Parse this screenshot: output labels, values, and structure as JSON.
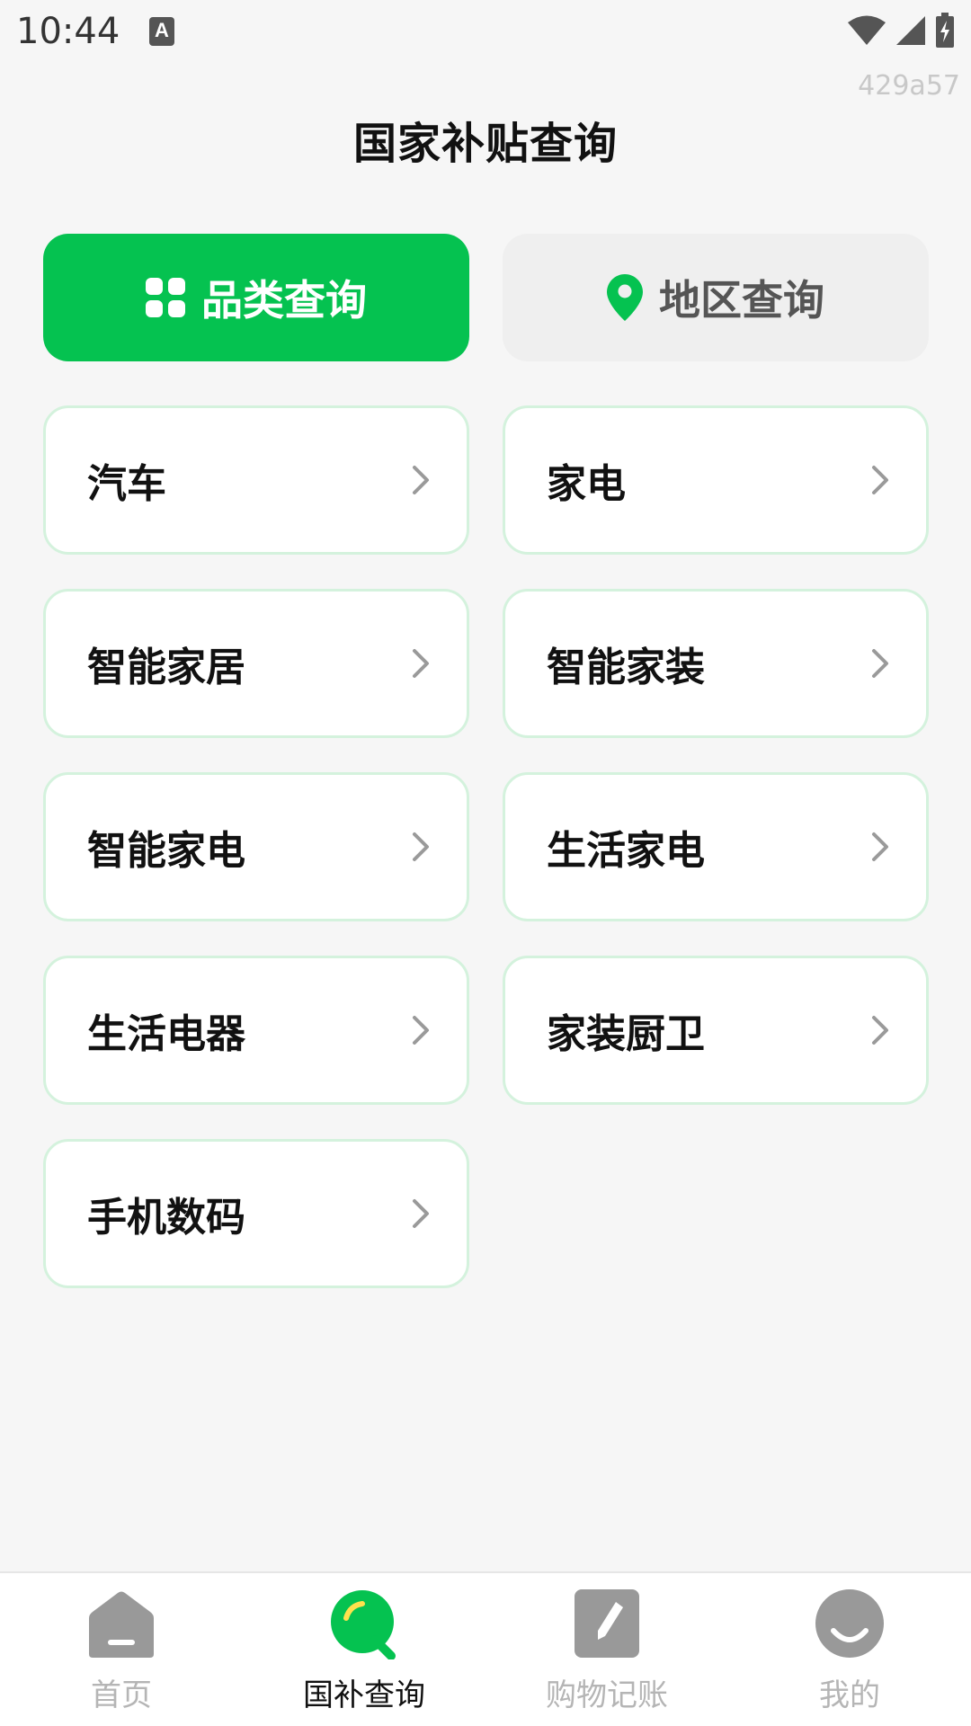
{
  "status_bar": {
    "time": "10:44",
    "notification_icon_letter": "A",
    "icons": [
      "a-notification-icon",
      "wifi-icon",
      "cell-signal-icon",
      "battery-icon"
    ]
  },
  "build_id": "429a57",
  "header": {
    "title": "国家补贴查询"
  },
  "tabs": [
    {
      "label": "品类查询",
      "icon": "grid-icon",
      "active": true
    },
    {
      "label": "地区查询",
      "icon": "location-pin-icon",
      "active": false
    }
  ],
  "categories": [
    {
      "label": "汽车"
    },
    {
      "label": "家电"
    },
    {
      "label": "智能家居"
    },
    {
      "label": "智能家装"
    },
    {
      "label": "智能家电"
    },
    {
      "label": "生活家电"
    },
    {
      "label": "生活电器"
    },
    {
      "label": "家装厨卫"
    },
    {
      "label": "手机数码"
    }
  ],
  "bottom_nav": [
    {
      "label": "首页",
      "icon": "home-icon",
      "active": false
    },
    {
      "label": "国补查询",
      "icon": "search-icon",
      "active": true
    },
    {
      "label": "购物记账",
      "icon": "notebook-pen-icon",
      "active": false
    },
    {
      "label": "我的",
      "icon": "profile-smile-icon",
      "active": false
    }
  ],
  "colors": {
    "accent": "#05c250",
    "background": "#f6f6f6",
    "card_border": "#d4f2dd",
    "inactive_tab_bg": "#efefef",
    "nav_inactive": "#b5b5b5"
  }
}
